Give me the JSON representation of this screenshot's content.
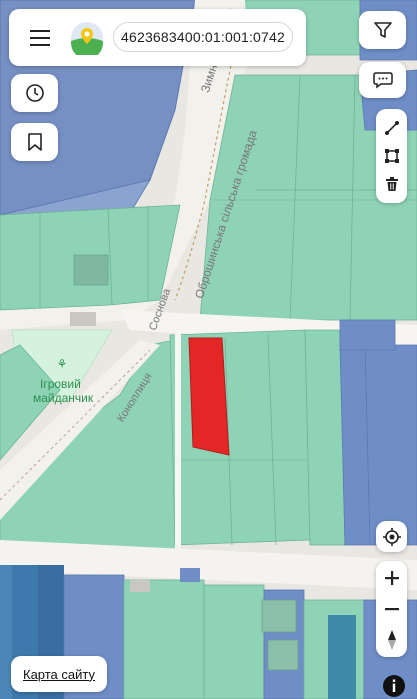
{
  "search": {
    "value": "4623683400:01:001:0742"
  },
  "map_labels": {
    "street1": "Зимноводівська",
    "community": "Оброшинська сільська громада",
    "street_sosnova": "Соснова",
    "street_konopnytsia": "Коноплиця",
    "playground_line1": "Ігровий",
    "playground_line2": "майданчик"
  },
  "footer": {
    "site_map": "Карта сайту"
  },
  "icons": {
    "menu": "hamburger-icon",
    "logo": "app-logo",
    "filter": "filter-icon",
    "chat": "chat-icon",
    "history": "clock-icon",
    "bookmark": "bookmark-icon",
    "draw_line": "line-tool-icon",
    "draw_polygon": "polygon-tool-icon",
    "delete": "trash-icon",
    "locate": "locate-icon",
    "zoom_in": "plus-icon",
    "zoom_out": "minus-icon",
    "compass": "compass-icon",
    "info": "info-icon"
  },
  "colors": {
    "parcel_green": "#8fd3b6",
    "parcel_blue": "#6f8ec8",
    "selected_parcel": "#e32626",
    "road": "#f1efe9"
  }
}
